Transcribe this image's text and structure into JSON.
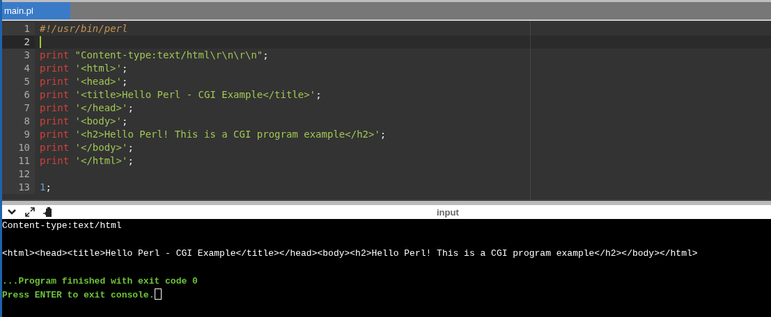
{
  "tabs": [
    {
      "label": "main.pl",
      "selected": true
    }
  ],
  "editor": {
    "lines": [
      {
        "number": "1",
        "current": false,
        "tokens": [
          {
            "kind": "comment",
            "text": "#!/usr/bin/perl"
          }
        ]
      },
      {
        "number": "2",
        "current": true
      },
      {
        "number": "3",
        "current": false,
        "tokens": [
          {
            "kind": "keyword",
            "text": "print"
          },
          {
            "kind": "string",
            "text": "\"Content-type:text/html\\r\\n\\r\\n\""
          },
          {
            "kind": "punct",
            "text": ";"
          }
        ]
      },
      {
        "number": "4",
        "current": false,
        "tokens": [
          {
            "kind": "keyword",
            "text": "print"
          },
          {
            "kind": "string",
            "text": "'<html>'"
          },
          {
            "kind": "punct",
            "text": ";"
          }
        ]
      },
      {
        "number": "5",
        "current": false,
        "tokens": [
          {
            "kind": "keyword",
            "text": "print"
          },
          {
            "kind": "string",
            "text": "'<head>'"
          },
          {
            "kind": "punct",
            "text": ";"
          }
        ]
      },
      {
        "number": "6",
        "current": false,
        "tokens": [
          {
            "kind": "keyword",
            "text": "print"
          },
          {
            "kind": "string",
            "text": "'<title>Hello Perl - CGI Example</title>'"
          },
          {
            "kind": "punct",
            "text": ";"
          }
        ]
      },
      {
        "number": "7",
        "current": false,
        "tokens": [
          {
            "kind": "keyword",
            "text": "print"
          },
          {
            "kind": "string",
            "text": "'</head>'"
          },
          {
            "kind": "punct",
            "text": ";"
          }
        ]
      },
      {
        "number": "8",
        "current": false,
        "tokens": [
          {
            "kind": "keyword",
            "text": "print"
          },
          {
            "kind": "string",
            "text": "'<body>'"
          },
          {
            "kind": "punct",
            "text": ";"
          }
        ]
      },
      {
        "number": "9",
        "current": false,
        "tokens": [
          {
            "kind": "keyword",
            "text": "print"
          },
          {
            "kind": "string",
            "text": "'<h2>Hello Perl! This is a CGI program example</h2>'"
          },
          {
            "kind": "punct",
            "text": ";"
          }
        ]
      },
      {
        "number": "10",
        "current": false,
        "tokens": [
          {
            "kind": "keyword",
            "text": "print"
          },
          {
            "kind": "string",
            "text": "'</body>'"
          },
          {
            "kind": "punct",
            "text": ";"
          }
        ]
      },
      {
        "number": "11",
        "current": false,
        "tokens": [
          {
            "kind": "keyword",
            "text": "print"
          },
          {
            "kind": "string",
            "text": "'</html>'"
          },
          {
            "kind": "punct",
            "text": ";"
          }
        ]
      },
      {
        "number": "12",
        "current": false
      },
      {
        "number": "13",
        "current": false,
        "tokens": [
          {
            "kind": "number",
            "text": "1"
          },
          {
            "kind": "punct",
            "text": ";"
          }
        ]
      }
    ]
  },
  "console_toolbar": {
    "label": "input"
  },
  "console": {
    "blocks": [
      {
        "lines": [
          {
            "kind": "output",
            "cursor": false,
            "text": "Content-type:text/html"
          }
        ]
      },
      {
        "lines": [
          {
            "kind": "output",
            "cursor": false,
            "text": "<html><head><title>Hello Perl - CGI Example</title></head><body><h2>Hello Perl! This is a CGI program example</h2></body></html>"
          }
        ]
      },
      {
        "lines": [
          {
            "kind": "status",
            "cursor": false,
            "text": "...Program finished with exit code 0"
          },
          {
            "kind": "status",
            "cursor": true,
            "text": "Press ENTER to exit console."
          }
        ]
      }
    ]
  }
}
